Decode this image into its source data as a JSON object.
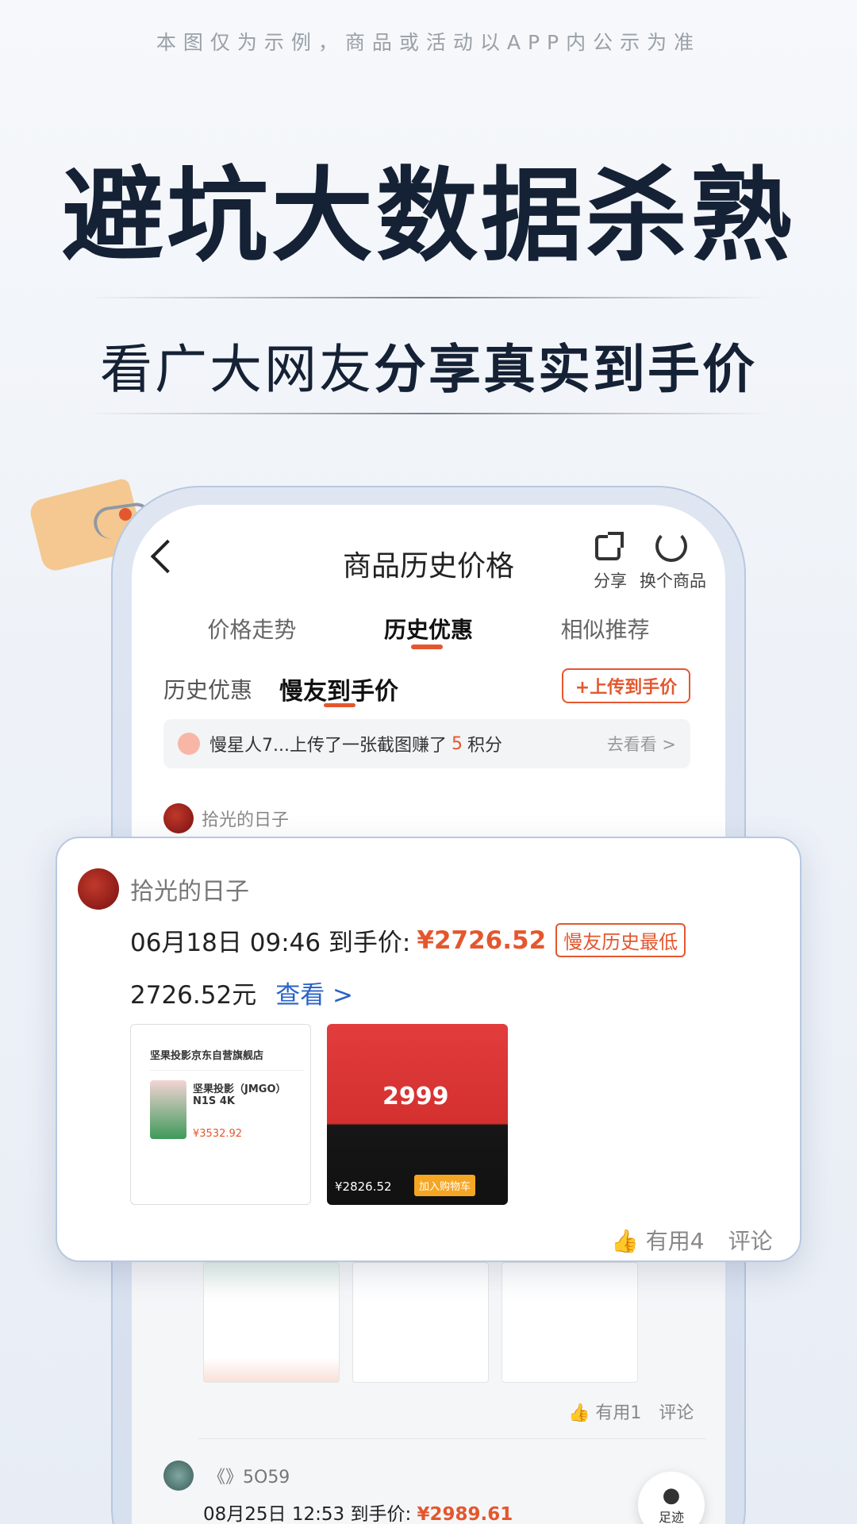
{
  "disclaimer": "本图仅为示例，商品或活动以APP内公示为准",
  "headline": "避坑大数据杀熟",
  "subline": {
    "normal": "看广大网友",
    "bold": "分享真实到手价"
  },
  "nav": {
    "title": "商品历史价格",
    "share": "分享",
    "swap": "换个商品"
  },
  "tabs": [
    "价格走势",
    "历史优惠",
    "相似推荐"
  ],
  "subtabs": {
    "history": "历史优惠",
    "friends": "慢友到手价",
    "upload": "+上传到手价"
  },
  "notice": {
    "prefix": "慢星人7...上传了一张截图赚了",
    "points": "5",
    "suffix": "积分",
    "go": "去看看 >"
  },
  "bg_user": "拾光的日子",
  "popup": {
    "user": "拾光的日子",
    "date": "06月18日 09:46 到手价:",
    "price": "¥2726.52",
    "badge": "慢友历史最低",
    "amount": "2726.52元",
    "link": "查看 >",
    "thumb1_shop": "坚果投影京东自营旗舰店",
    "thumb1_product": "坚果投影（JMGO）N1S 4K",
    "thumb1_price": "¥3532.92",
    "thumb2_price": "¥2826.52",
    "thumb2_cart": "加入购物车",
    "thumb2_big": "2999",
    "useful": "有用4",
    "comment": "评论"
  },
  "lower": {
    "useful": "有用1",
    "comment": "评论"
  },
  "user2": {
    "name": "《》5O59",
    "date": "08月25日 12:53 到手价:",
    "price": "¥2989.61"
  },
  "footprint": "足迹",
  "colors": {
    "accent": "#e4572e",
    "link": "#2a62c8",
    "dark": "#152135"
  }
}
